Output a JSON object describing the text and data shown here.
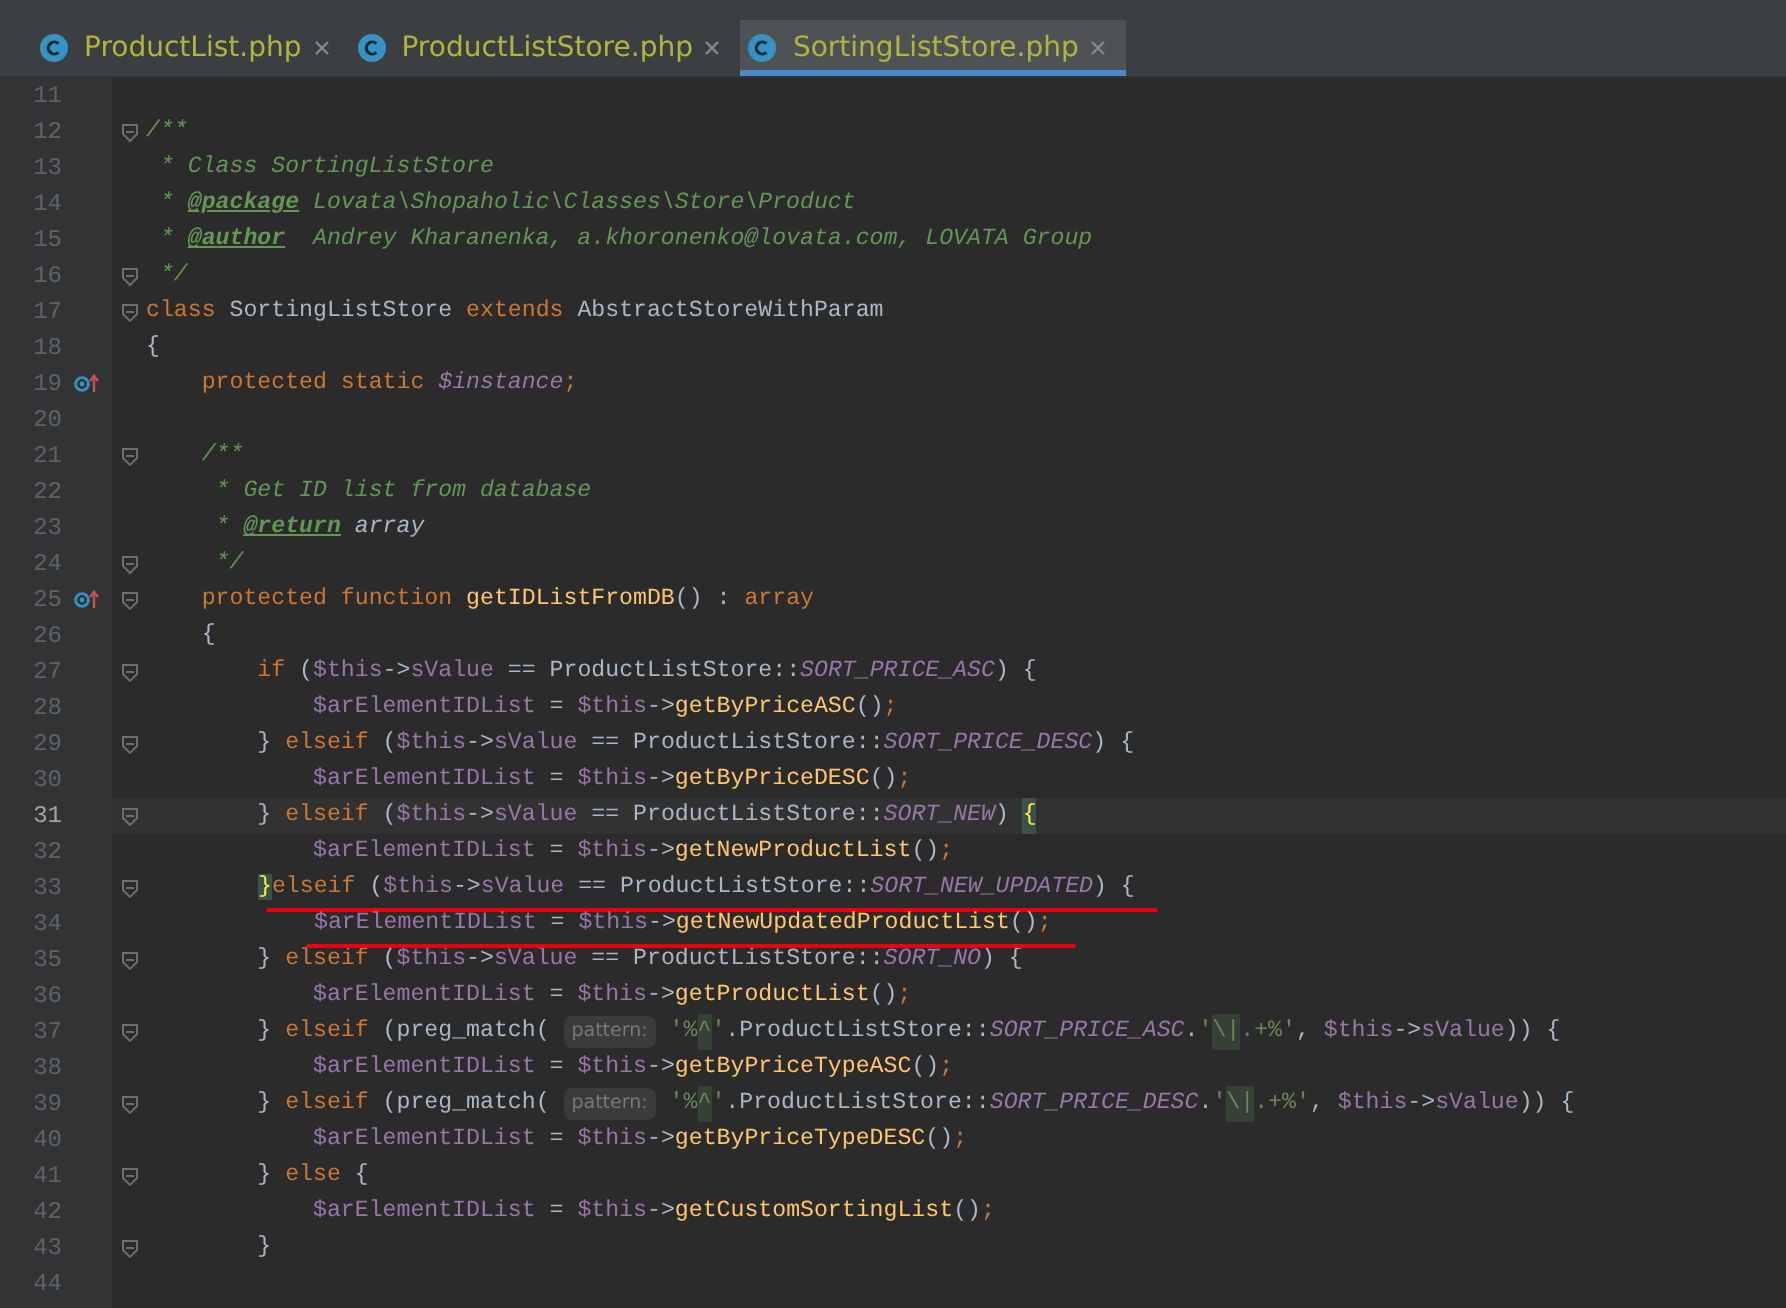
{
  "tabs": [
    {
      "label": "ProductList.php",
      "selected": false
    },
    {
      "label": "ProductListStore.php",
      "selected": false
    },
    {
      "label": "SortingListStore.php",
      "selected": true
    }
  ],
  "editor": {
    "lines": [
      {
        "number": "11",
        "current": false,
        "fold": false,
        "gutter_icon": false,
        "underlined": false
      },
      {
        "number": "12",
        "current": false,
        "fold": true,
        "gutter_icon": false,
        "underlined": false,
        "tokens": [
          {
            "kind": "comment",
            "text": "/**"
          }
        ]
      },
      {
        "number": "13",
        "current": false,
        "fold": false,
        "gutter_icon": false,
        "underlined": false,
        "tokens": [
          {
            "kind": "comment",
            "text": " * Class SortingListStore"
          }
        ]
      },
      {
        "number": "14",
        "current": false,
        "fold": false,
        "gutter_icon": false,
        "underlined": false,
        "tokens": [
          {
            "kind": "comment",
            "text": " * "
          },
          {
            "kind": "doctag",
            "text": "@package"
          },
          {
            "kind": "comment",
            "text": " Lovata\\Shopaholic\\Classes\\Store\\Product"
          }
        ]
      },
      {
        "number": "15",
        "current": false,
        "fold": false,
        "gutter_icon": false,
        "underlined": false,
        "tokens": [
          {
            "kind": "comment",
            "text": " * "
          },
          {
            "kind": "doctag",
            "text": "@author"
          },
          {
            "kind": "comment",
            "text": "  Andrey Kharanenka, a.khoronenko@lovata.com, LOVATA Group"
          }
        ]
      },
      {
        "number": "16",
        "current": false,
        "fold": true,
        "gutter_icon": false,
        "underlined": false,
        "tokens": [
          {
            "kind": "comment",
            "text": " */"
          }
        ]
      },
      {
        "number": "17",
        "current": false,
        "fold": true,
        "gutter_icon": false,
        "underlined": false,
        "tokens": [
          {
            "kind": "kw",
            "text": "class"
          },
          {
            "kind": "plain",
            "text": " SortingListStore "
          },
          {
            "kind": "kw",
            "text": "extends"
          },
          {
            "kind": "plain",
            "text": " AbstractStoreWithParam"
          }
        ]
      },
      {
        "number": "18",
        "current": false,
        "fold": false,
        "gutter_icon": false,
        "underlined": false,
        "tokens": [
          {
            "kind": "plain",
            "text": "{"
          }
        ]
      },
      {
        "number": "19",
        "current": false,
        "fold": false,
        "gutter_icon": true,
        "underlined": false,
        "tokens": [
          {
            "kind": "kw",
            "text": "    protected static "
          },
          {
            "kind": "var-i",
            "text": "$instance"
          },
          {
            "kind": "kw",
            "text": ";"
          }
        ]
      },
      {
        "number": "20",
        "current": false,
        "fold": false,
        "gutter_icon": false,
        "underlined": false
      },
      {
        "number": "21",
        "current": false,
        "fold": true,
        "gutter_icon": false,
        "underlined": false,
        "tokens": [
          {
            "kind": "comment",
            "text": "    /**"
          }
        ]
      },
      {
        "number": "22",
        "current": false,
        "fold": false,
        "gutter_icon": false,
        "underlined": false,
        "tokens": [
          {
            "kind": "comment",
            "text": "     * Get ID list from database"
          }
        ]
      },
      {
        "number": "23",
        "current": false,
        "fold": false,
        "gutter_icon": false,
        "underlined": false,
        "tokens": [
          {
            "kind": "comment",
            "text": "     * "
          },
          {
            "kind": "doctag",
            "text": "@return"
          },
          {
            "kind": "doctype",
            "text": " array"
          }
        ]
      },
      {
        "number": "24",
        "current": false,
        "fold": true,
        "gutter_icon": false,
        "underlined": false,
        "tokens": [
          {
            "kind": "comment",
            "text": "     */"
          }
        ]
      },
      {
        "number": "25",
        "current": false,
        "fold": true,
        "gutter_icon": true,
        "underlined": false,
        "tokens": [
          {
            "kind": "kw",
            "text": "    protected function "
          },
          {
            "kind": "fn",
            "text": "getIDListFromDB"
          },
          {
            "kind": "plain",
            "text": "() : "
          },
          {
            "kind": "kw",
            "text": "array"
          }
        ]
      },
      {
        "number": "26",
        "current": false,
        "fold": false,
        "gutter_icon": false,
        "underlined": false,
        "tokens": [
          {
            "kind": "plain",
            "text": "    {"
          }
        ]
      },
      {
        "number": "27",
        "current": false,
        "fold": true,
        "gutter_icon": false,
        "underlined": false,
        "tokens": [
          {
            "kind": "kw",
            "text": "        if"
          },
          {
            "kind": "plain",
            "text": " ("
          },
          {
            "kind": "var",
            "text": "$this"
          },
          {
            "kind": "plain",
            "text": "->"
          },
          {
            "kind": "var",
            "text": "sValue"
          },
          {
            "kind": "plain",
            "text": " == ProductListStore::"
          },
          {
            "kind": "const",
            "text": "SORT_PRICE_ASC"
          },
          {
            "kind": "plain",
            "text": ") {"
          }
        ]
      },
      {
        "number": "28",
        "current": false,
        "fold": false,
        "gutter_icon": false,
        "underlined": false,
        "tokens": [
          {
            "kind": "var",
            "text": "            $arElementIDList"
          },
          {
            "kind": "plain",
            "text": " = "
          },
          {
            "kind": "var",
            "text": "$this"
          },
          {
            "kind": "plain",
            "text": "->"
          },
          {
            "kind": "fn",
            "text": "getByPriceASC"
          },
          {
            "kind": "plain",
            "text": "()"
          },
          {
            "kind": "kw",
            "text": ";"
          }
        ]
      },
      {
        "number": "29",
        "current": false,
        "fold": true,
        "gutter_icon": false,
        "underlined": false,
        "tokens": [
          {
            "kind": "plain",
            "text": "        } "
          },
          {
            "kind": "kw",
            "text": "elseif"
          },
          {
            "kind": "plain",
            "text": " ("
          },
          {
            "kind": "var",
            "text": "$this"
          },
          {
            "kind": "plain",
            "text": "->"
          },
          {
            "kind": "var",
            "text": "sValue"
          },
          {
            "kind": "plain",
            "text": " == ProductListStore::"
          },
          {
            "kind": "const",
            "text": "SORT_PRICE_DESC"
          },
          {
            "kind": "plain",
            "text": ") {"
          }
        ]
      },
      {
        "number": "30",
        "current": false,
        "fold": false,
        "gutter_icon": false,
        "underlined": false,
        "tokens": [
          {
            "kind": "var",
            "text": "            $arElementIDList"
          },
          {
            "kind": "plain",
            "text": " = "
          },
          {
            "kind": "var",
            "text": "$this"
          },
          {
            "kind": "plain",
            "text": "->"
          },
          {
            "kind": "fn",
            "text": "getByPriceDESC"
          },
          {
            "kind": "plain",
            "text": "()"
          },
          {
            "kind": "kw",
            "text": ";"
          }
        ]
      },
      {
        "number": "31",
        "current": true,
        "fold": true,
        "gutter_icon": false,
        "underlined": false,
        "tokens": [
          {
            "kind": "plain",
            "text": "        } "
          },
          {
            "kind": "kw",
            "text": "elseif"
          },
          {
            "kind": "plain",
            "text": " ("
          },
          {
            "kind": "var",
            "text": "$this"
          },
          {
            "kind": "plain",
            "text": "->"
          },
          {
            "kind": "var",
            "text": "sValue"
          },
          {
            "kind": "plain",
            "text": " == ProductListStore::"
          },
          {
            "kind": "const",
            "text": "SORT_NEW"
          },
          {
            "kind": "plain",
            "text": ") "
          },
          {
            "kind": "brace",
            "text": "{"
          }
        ]
      },
      {
        "number": "32",
        "current": false,
        "fold": false,
        "gutter_icon": false,
        "underlined": false,
        "tokens": [
          {
            "kind": "var",
            "text": "            $arElementIDList"
          },
          {
            "kind": "plain",
            "text": " = "
          },
          {
            "kind": "var",
            "text": "$this"
          },
          {
            "kind": "plain",
            "text": "->"
          },
          {
            "kind": "fn",
            "text": "getNewProductList"
          },
          {
            "kind": "plain",
            "text": "()"
          },
          {
            "kind": "kw",
            "text": ";"
          }
        ]
      },
      {
        "number": "33",
        "current": false,
        "fold": true,
        "gutter_icon": false,
        "underlined": true,
        "tokens": [
          {
            "kind": "brace",
            "text": "}"
          },
          {
            "kind": "kw",
            "text": "elseif"
          },
          {
            "kind": "plain",
            "text": " ("
          },
          {
            "kind": "var",
            "text": "$this"
          },
          {
            "kind": "plain",
            "text": "->"
          },
          {
            "kind": "var",
            "text": "sValue"
          },
          {
            "kind": "plain",
            "text": " == ProductListStore::"
          },
          {
            "kind": "const",
            "text": "SORT_NEW_UPDATED"
          },
          {
            "kind": "plain",
            "text": ") {"
          }
        ]
      },
      {
        "number": "34",
        "current": false,
        "fold": false,
        "gutter_icon": false,
        "underlined": true,
        "tokens": [
          {
            "kind": "var",
            "text": "$arElementIDList"
          },
          {
            "kind": "plain",
            "text": " = "
          },
          {
            "kind": "var",
            "text": "$this"
          },
          {
            "kind": "plain",
            "text": "->"
          },
          {
            "kind": "fn",
            "text": "getNewUpdatedProductList"
          },
          {
            "kind": "plain",
            "text": "()"
          },
          {
            "kind": "kw",
            "text": ";"
          }
        ]
      },
      {
        "number": "35",
        "current": false,
        "fold": true,
        "gutter_icon": false,
        "underlined": false,
        "tokens": [
          {
            "kind": "plain",
            "text": "        } "
          },
          {
            "kind": "kw",
            "text": "elseif"
          },
          {
            "kind": "plain",
            "text": " ("
          },
          {
            "kind": "var",
            "text": "$this"
          },
          {
            "kind": "plain",
            "text": "->"
          },
          {
            "kind": "var",
            "text": "sValue"
          },
          {
            "kind": "plain",
            "text": " == ProductListStore::"
          },
          {
            "kind": "const",
            "text": "SORT_NO"
          },
          {
            "kind": "plain",
            "text": ") {"
          }
        ]
      },
      {
        "number": "36",
        "current": false,
        "fold": false,
        "gutter_icon": false,
        "underlined": false,
        "tokens": [
          {
            "kind": "var",
            "text": "            $arElementIDList"
          },
          {
            "kind": "plain",
            "text": " = "
          },
          {
            "kind": "var",
            "text": "$this"
          },
          {
            "kind": "plain",
            "text": "->"
          },
          {
            "kind": "fn",
            "text": "getProductList"
          },
          {
            "kind": "plain",
            "text": "()"
          },
          {
            "kind": "kw",
            "text": ";"
          }
        ]
      },
      {
        "number": "37",
        "current": false,
        "fold": true,
        "gutter_icon": false,
        "underlined": false,
        "tokens": [
          {
            "kind": "plain",
            "text": "        } "
          },
          {
            "kind": "kw",
            "text": "elseif"
          },
          {
            "kind": "plain",
            "text": " (preg_match( "
          },
          {
            "kind": "hint",
            "text": "pattern:"
          },
          {
            "kind": "str",
            "text": " '%"
          },
          {
            "kind": "strhl",
            "text": "^"
          },
          {
            "kind": "str",
            "text": "'"
          },
          {
            "kind": "plain",
            "text": ".ProductListStore::"
          },
          {
            "kind": "const",
            "text": "SORT_PRICE_ASC"
          },
          {
            "kind": "plain",
            "text": "."
          },
          {
            "kind": "str",
            "text": "'"
          },
          {
            "kind": "strhl",
            "text": "\\|"
          },
          {
            "kind": "str",
            "text": ".+%'"
          },
          {
            "kind": "plain",
            "text": ", "
          },
          {
            "kind": "var",
            "text": "$this"
          },
          {
            "kind": "plain",
            "text": "->"
          },
          {
            "kind": "var",
            "text": "sValue"
          },
          {
            "kind": "plain",
            "text": ")) {"
          }
        ]
      },
      {
        "number": "38",
        "current": false,
        "fold": false,
        "gutter_icon": false,
        "underlined": false,
        "tokens": [
          {
            "kind": "var",
            "text": "            $arElementIDList"
          },
          {
            "kind": "plain",
            "text": " = "
          },
          {
            "kind": "var",
            "text": "$this"
          },
          {
            "kind": "plain",
            "text": "->"
          },
          {
            "kind": "fn",
            "text": "getByPriceTypeASC"
          },
          {
            "kind": "plain",
            "text": "()"
          },
          {
            "kind": "kw",
            "text": ";"
          }
        ]
      },
      {
        "number": "39",
        "current": false,
        "fold": true,
        "gutter_icon": false,
        "underlined": false,
        "tokens": [
          {
            "kind": "plain",
            "text": "        } "
          },
          {
            "kind": "kw",
            "text": "elseif"
          },
          {
            "kind": "plain",
            "text": " (preg_match( "
          },
          {
            "kind": "hint",
            "text": "pattern:"
          },
          {
            "kind": "str",
            "text": " '%"
          },
          {
            "kind": "strhl",
            "text": "^"
          },
          {
            "kind": "str",
            "text": "'"
          },
          {
            "kind": "plain",
            "text": ".ProductListStore::"
          },
          {
            "kind": "const",
            "text": "SORT_PRICE_DESC"
          },
          {
            "kind": "plain",
            "text": "."
          },
          {
            "kind": "str",
            "text": "'"
          },
          {
            "kind": "strhl",
            "text": "\\|"
          },
          {
            "kind": "str",
            "text": ".+%'"
          },
          {
            "kind": "plain",
            "text": ", "
          },
          {
            "kind": "var",
            "text": "$this"
          },
          {
            "kind": "plain",
            "text": "->"
          },
          {
            "kind": "var",
            "text": "sValue"
          },
          {
            "kind": "plain",
            "text": ")) {"
          }
        ]
      },
      {
        "number": "40",
        "current": false,
        "fold": false,
        "gutter_icon": false,
        "underlined": false,
        "tokens": [
          {
            "kind": "var",
            "text": "            $arElementIDList"
          },
          {
            "kind": "plain",
            "text": " = "
          },
          {
            "kind": "var",
            "text": "$this"
          },
          {
            "kind": "plain",
            "text": "->"
          },
          {
            "kind": "fn",
            "text": "getByPriceTypeDESC"
          },
          {
            "kind": "plain",
            "text": "()"
          },
          {
            "kind": "kw",
            "text": ";"
          }
        ]
      },
      {
        "number": "41",
        "current": false,
        "fold": true,
        "gutter_icon": false,
        "underlined": false,
        "tokens": [
          {
            "kind": "plain",
            "text": "        } "
          },
          {
            "kind": "kw",
            "text": "else"
          },
          {
            "kind": "plain",
            "text": " {"
          }
        ]
      },
      {
        "number": "42",
        "current": false,
        "fold": false,
        "gutter_icon": false,
        "underlined": false,
        "tokens": [
          {
            "kind": "var",
            "text": "            $arElementIDList"
          },
          {
            "kind": "plain",
            "text": " = "
          },
          {
            "kind": "var",
            "text": "$this"
          },
          {
            "kind": "plain",
            "text": "->"
          },
          {
            "kind": "fn",
            "text": "getCustomSortingList"
          },
          {
            "kind": "plain",
            "text": "()"
          },
          {
            "kind": "kw",
            "text": ";"
          }
        ]
      },
      {
        "number": "43",
        "current": false,
        "fold": true,
        "gutter_icon": false,
        "underlined": false,
        "tokens": [
          {
            "kind": "plain",
            "text": "        }"
          }
        ]
      },
      {
        "number": "44",
        "current": false,
        "fold": false,
        "gutter_icon": false,
        "underlined": false
      }
    ]
  }
}
